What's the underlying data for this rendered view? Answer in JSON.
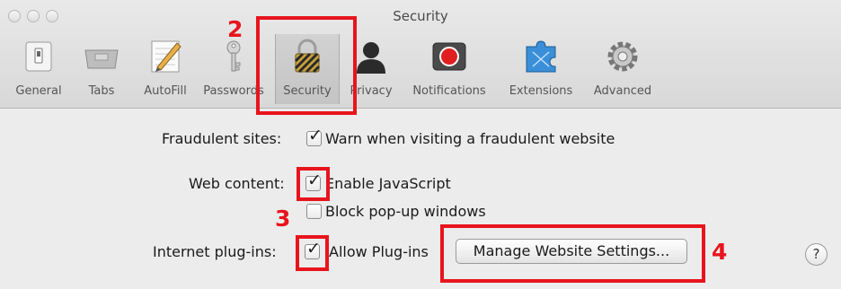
{
  "window": {
    "title": "Security"
  },
  "toolbar": {
    "tabs": [
      {
        "label": "General",
        "icon": "general-switch-icon"
      },
      {
        "label": "Tabs",
        "icon": "tabs-icon"
      },
      {
        "label": "AutoFill",
        "icon": "autofill-pencil-icon"
      },
      {
        "label": "Passwords",
        "icon": "key-icon"
      },
      {
        "label": "Security",
        "icon": "padlock-icon",
        "selected": true
      },
      {
        "label": "Privacy",
        "icon": "person-silhouette-icon"
      },
      {
        "label": "Notifications",
        "icon": "notification-record-icon"
      },
      {
        "label": "Extensions",
        "icon": "extensions-puzzle-icon"
      },
      {
        "label": "Advanced",
        "icon": "gear-icon"
      }
    ]
  },
  "settings": {
    "fraudulent_label": "Fraudulent sites:",
    "fraudulent_option": "Warn when visiting a fraudulent website",
    "web_content_label": "Web content:",
    "javascript_option": "Enable JavaScript",
    "popup_option": "Block pop-up windows",
    "plugins_label": "Internet plug-ins:",
    "plugins_option": "Allow Plug-ins",
    "manage_button": "Manage Website Settings...",
    "help": "?"
  },
  "checkbox_states": {
    "warn_fraudulent": true,
    "enable_javascript": true,
    "block_popups": false,
    "allow_plugins": true
  },
  "annotations": {
    "step2": "2",
    "step3": "3",
    "step4": "4"
  },
  "colors": {
    "annotation_red": "#e8141d",
    "window_bg": "#ececec"
  }
}
